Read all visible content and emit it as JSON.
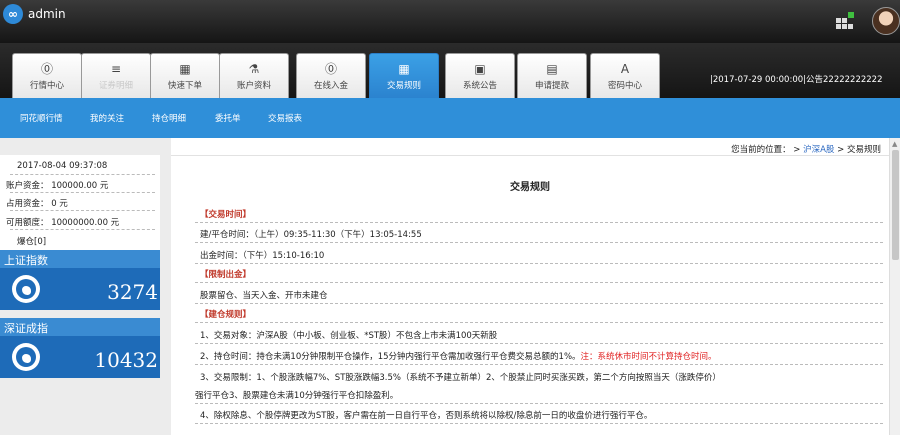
{
  "header": {
    "logo_text": "admin",
    "info": "|2017-07-29 00:00:00|公告22222222222"
  },
  "tabs": [
    {
      "icon": "tachometer-icon",
      "glyph": "⓪",
      "label": "行情中心"
    },
    {
      "icon": "list-icon",
      "glyph": "≡",
      "label": "证券明细"
    },
    {
      "icon": "chart-icon",
      "glyph": "▦",
      "label": "快速下单"
    },
    {
      "icon": "flask-icon",
      "glyph": "⚗",
      "label": "账户资料"
    },
    {
      "icon": "dashboard-icon",
      "glyph": "⓪",
      "label": "在线入金"
    },
    {
      "icon": "table-icon",
      "glyph": "▦",
      "label": "交易规则"
    },
    {
      "icon": "picture-icon",
      "glyph": "▣",
      "label": "系统公告"
    },
    {
      "icon": "calendar-icon",
      "glyph": "▤",
      "label": "申请提款"
    },
    {
      "icon": "font-icon",
      "glyph": "A",
      "label": "密码中心"
    }
  ],
  "subnav": [
    "同花顺行情",
    "我的关注",
    "持仓明细",
    "委托单",
    "交易报表"
  ],
  "account": {
    "date": "2017-08-04 09:37:08",
    "balance": "账户资金： 100000.00 元",
    "occupied": "占用资金： 0  元",
    "quota": "可用额度： 10000000.00 元",
    "liquidation": "爆仓[0]"
  },
  "indices": [
    {
      "name": "上证指数",
      "value": "3274"
    },
    {
      "name": "深证成指",
      "value": "10432"
    }
  ],
  "breadcrumb": {
    "prefix": "您当前的位置：",
    "sep1": " > ",
    "link": "沪深A股",
    "sep2": " > ",
    "current": "交易规则"
  },
  "page_title": "交易规则",
  "rules": {
    "h1": "【交易时间】",
    "l1": "建/平仓时间：（上午）09:35-11:30（下午）13:05-14:55",
    "l2": "出金时间：（下午）15:10-16:10",
    "h2": "【限制出金】",
    "l3": "股票留仓、当天入金、开市未建仓",
    "h3": "【建仓规则】",
    "r1": "1、交易对象：沪深A股（中小板、创业板、*ST股）不包含上市未满100天新股",
    "r2": "2、持仓时间：持仓未满10分钟限制平仓操作，15分钟内强行平仓需加收强行平仓费交易总额的1%。",
    "r2_red": "注：系统休市时间不计算持仓时间。",
    "r3a": "3、交易限制：1、个股涨跌幅7%、ST股涨跌幅3.5%（系统不予建立新单）2、个股禁止同时买涨买跌，第二个方向按照当天（涨跌停价）",
    "r3b": "强行平仓3、股票建仓未满10分钟强行平仓扣除盈利。",
    "r4": "4、除权除息、个股停牌更改为ST股，客户需在前一日自行平仓，否则系统将以除权/除息前一日的收盘价进行强行平仓。"
  }
}
